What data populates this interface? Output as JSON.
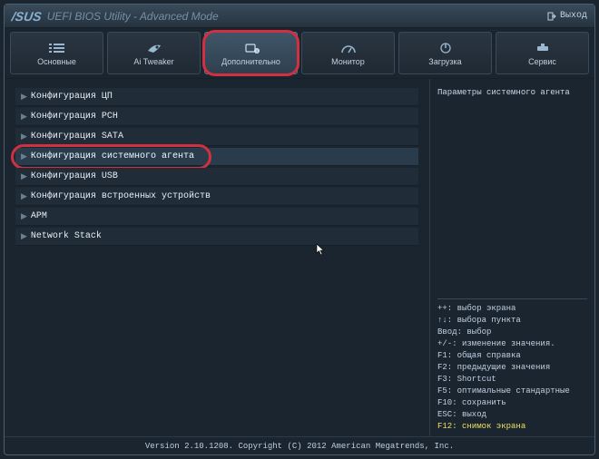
{
  "header": {
    "brand": "/SUS",
    "title": "UEFI BIOS Utility - Advanced Mode",
    "exit": "Выход"
  },
  "tabs": [
    {
      "key": "main",
      "label": "Основные"
    },
    {
      "key": "aitweaker",
      "label": "Ai Tweaker"
    },
    {
      "key": "advanced",
      "label": "Дополнительно"
    },
    {
      "key": "monitor",
      "label": "Монитор"
    },
    {
      "key": "boot",
      "label": "Загрузка"
    },
    {
      "key": "service",
      "label": "Сервис"
    }
  ],
  "menu": {
    "items": [
      "Конфигурация ЦП",
      "Конфигурация PCH",
      "Конфигурация SATA",
      "Конфигурация системного агента",
      "Конфигурация USB",
      "Конфигурация встроенных устройств",
      "APM",
      "Network Stack"
    ]
  },
  "description": "Параметры системного агента",
  "keyhelp": [
    {
      "text": "++: выбор экрана",
      "hot": false
    },
    {
      "text": "↑↓: выбора пункта",
      "hot": false
    },
    {
      "text": "Ввод: выбор",
      "hot": false
    },
    {
      "text": "+/-: изменение значения.",
      "hot": false
    },
    {
      "text": "F1: общая справка",
      "hot": false
    },
    {
      "text": "F2: предыдущие значения",
      "hot": false
    },
    {
      "text": "F3: Shortcut",
      "hot": false
    },
    {
      "text": "F5: оптимальные стандартные",
      "hot": false
    },
    {
      "text": "F10: сохранить",
      "hot": false
    },
    {
      "text": "ESC: выход",
      "hot": false
    },
    {
      "text": "F12: снимок экрана",
      "hot": true
    }
  ],
  "footer": "Version 2.10.1208. Copyright (C) 2012 American Megatrends, Inc."
}
